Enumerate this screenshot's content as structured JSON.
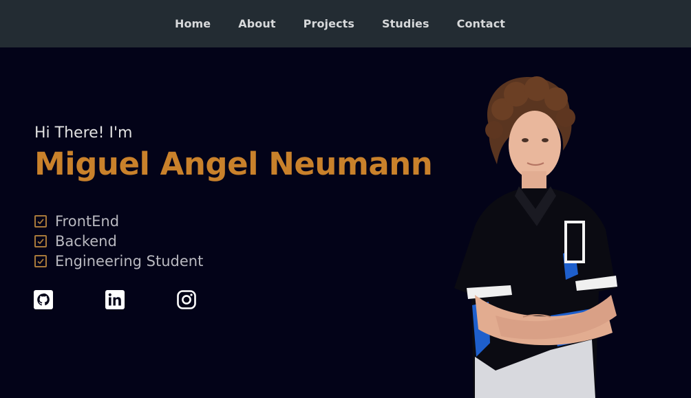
{
  "nav": {
    "items": [
      {
        "label": "Home"
      },
      {
        "label": "About"
      },
      {
        "label": "Projects"
      },
      {
        "label": "Studies"
      },
      {
        "label": "Contact"
      }
    ]
  },
  "hero": {
    "greeting": "Hi There! I'm",
    "name": "Miguel Angel Neumann",
    "skills": [
      {
        "label": "FrontEnd"
      },
      {
        "label": "Backend"
      },
      {
        "label": "Engineering Student"
      }
    ],
    "socials": [
      {
        "icon": "github-icon"
      },
      {
        "icon": "linkedin-icon"
      },
      {
        "icon": "instagram-icon"
      }
    ]
  },
  "colors": {
    "nav_bg": "#232c33",
    "page_bg": "#030318",
    "accent": "#c9812b",
    "check": "#a97a3b"
  }
}
